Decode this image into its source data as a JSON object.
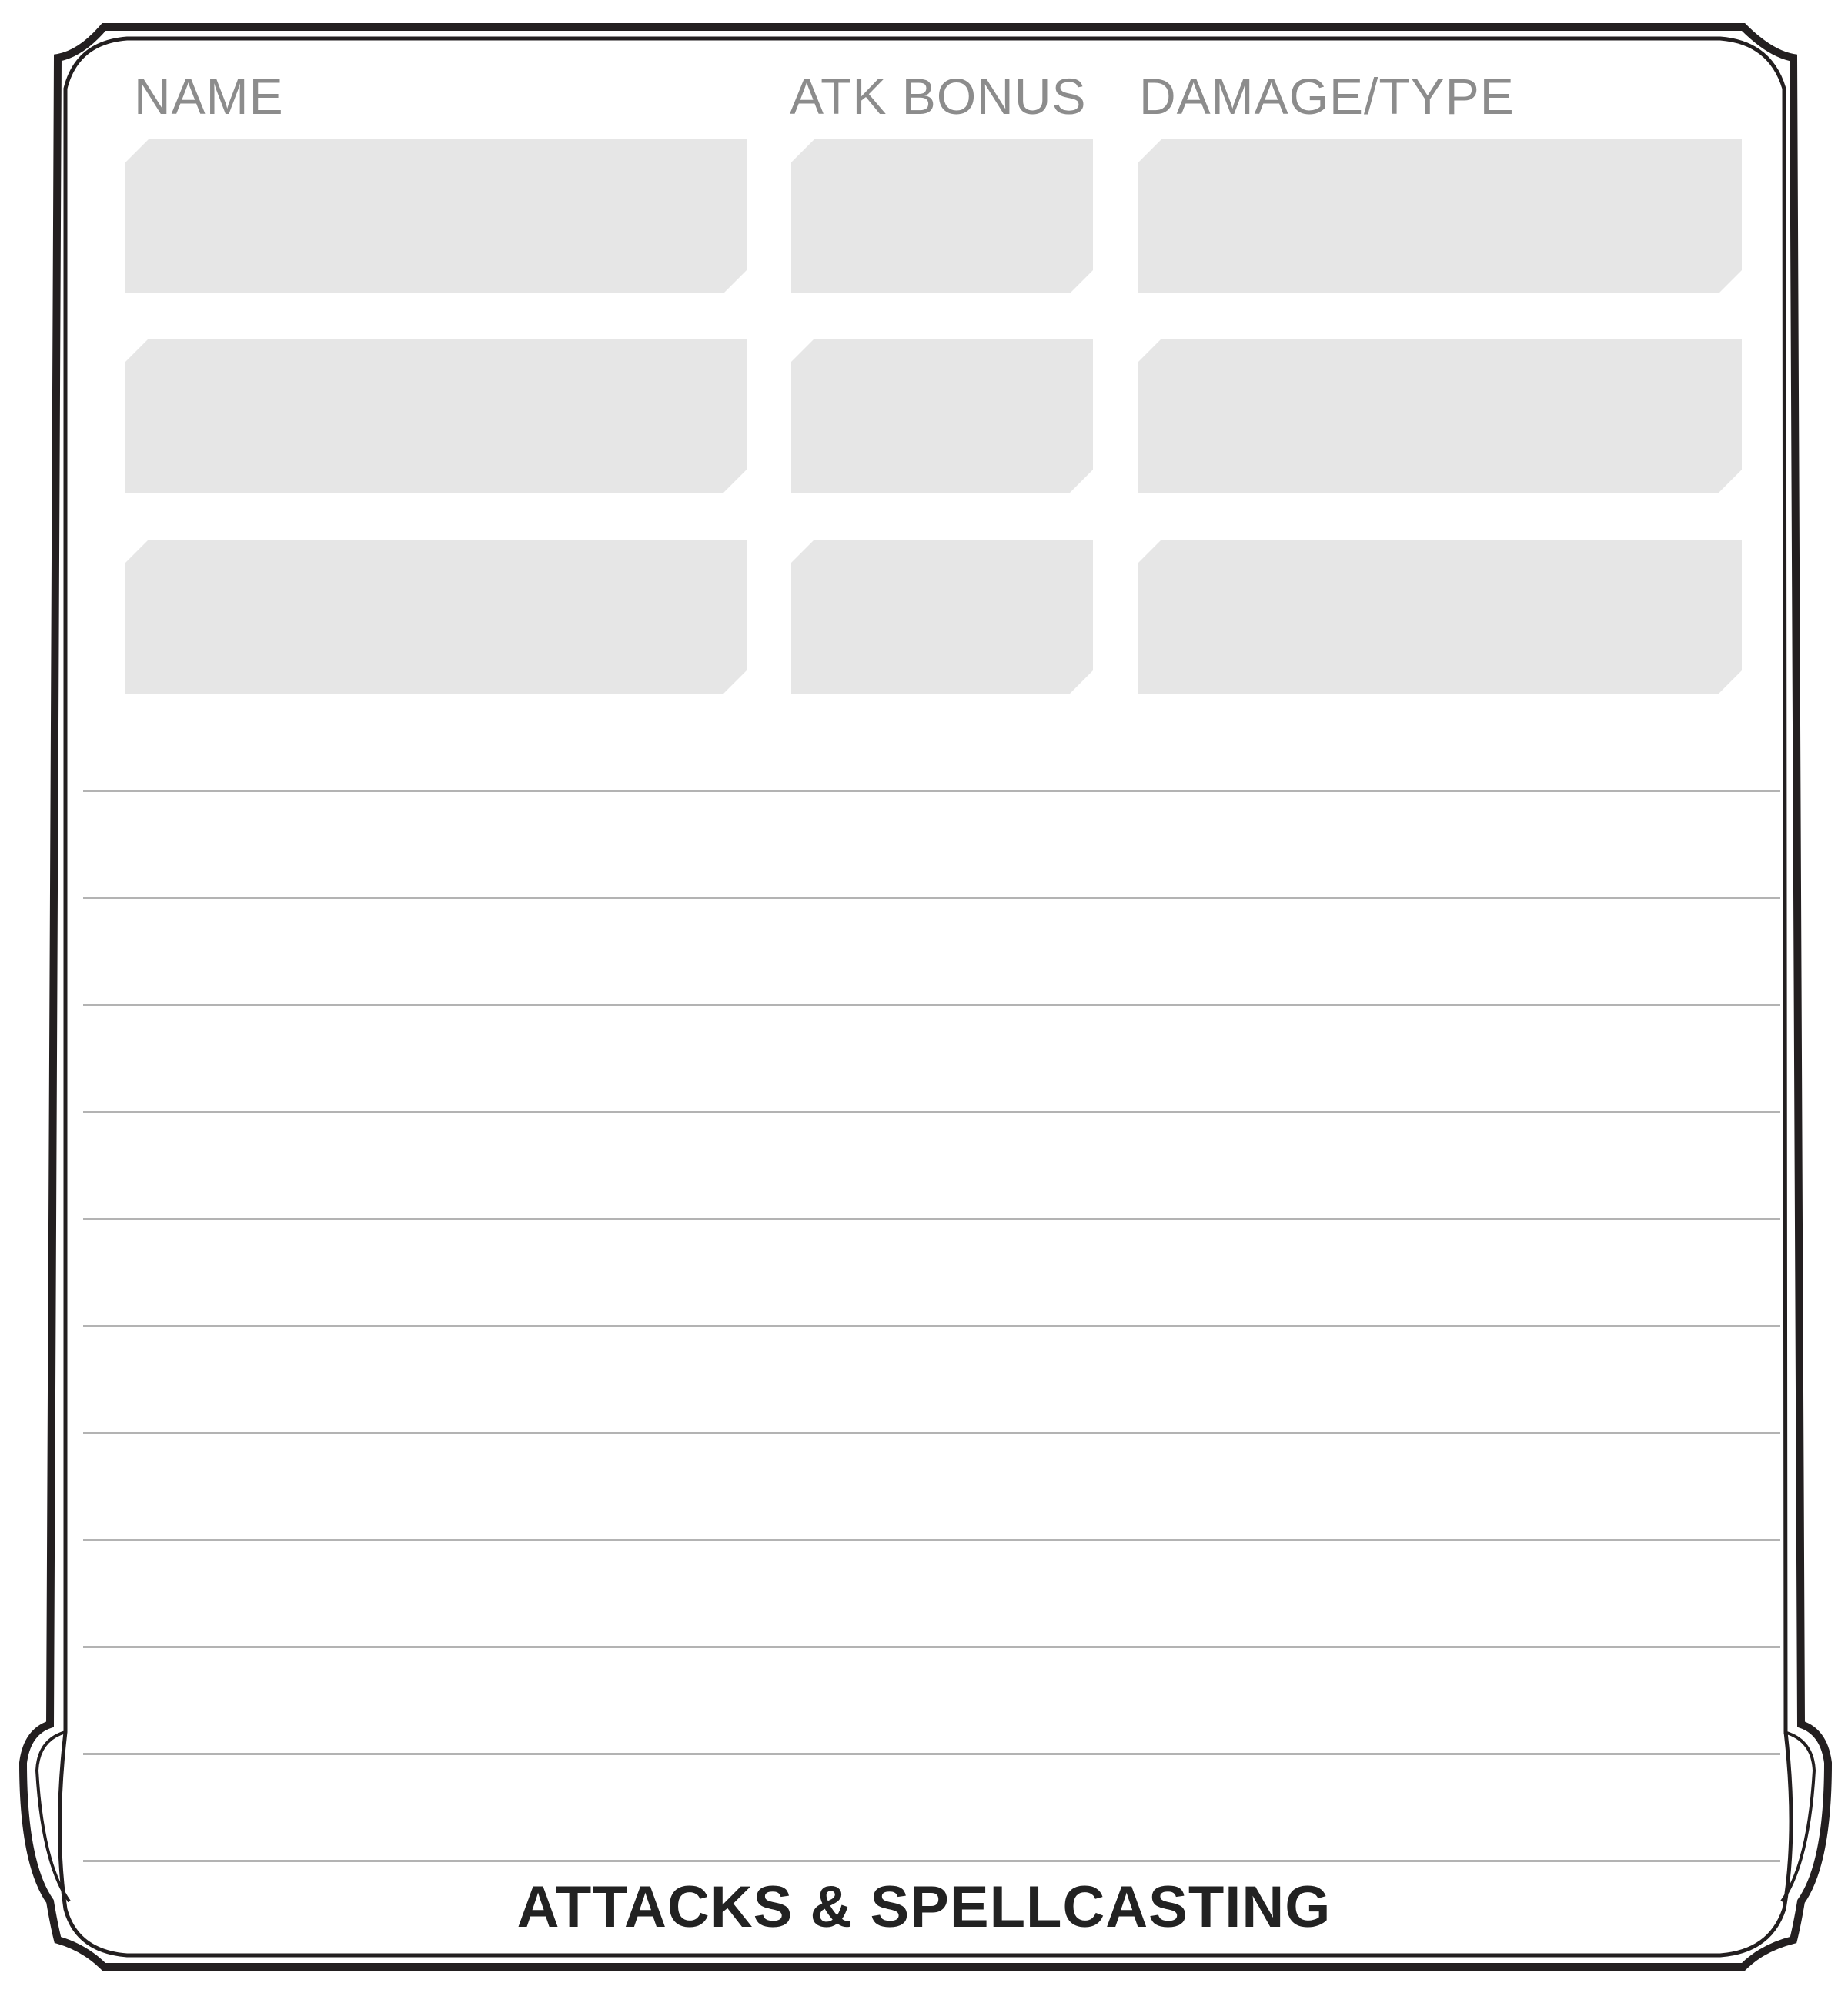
{
  "columns": {
    "name": "NAME",
    "atk_bonus": "ATK BONUS",
    "damage_type": "DAMAGE/TYPE"
  },
  "attacks": [
    {
      "name": "",
      "atk_bonus": "",
      "damage_type": ""
    },
    {
      "name": "",
      "atk_bonus": "",
      "damage_type": ""
    },
    {
      "name": "",
      "atk_bonus": "",
      "damage_type": ""
    }
  ],
  "notes": [
    "",
    "",
    "",
    "",
    "",
    "",
    "",
    "",
    "",
    "",
    ""
  ],
  "section_title": "ATTACKS & SPELLCASTING",
  "colors": {
    "frame": "#231f20",
    "label": "#8c8c8c",
    "field_fill": "#e6e6e6",
    "rule": "#b3b3b3",
    "title": "#222222"
  }
}
